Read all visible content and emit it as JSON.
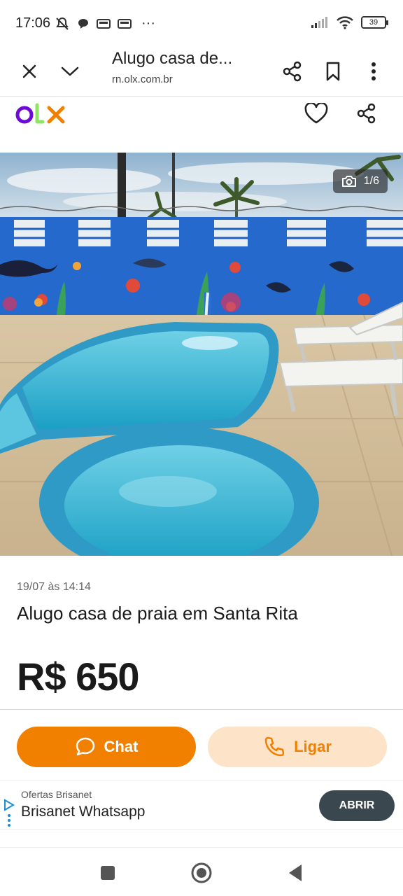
{
  "status_bar": {
    "time": "17:06",
    "notification_icons": [
      "mute-icon",
      "chat-icon",
      "news-icon",
      "news-icon"
    ],
    "more": "···",
    "battery": "39"
  },
  "browser": {
    "page_title": "Alugo casa de...",
    "domain": "rn.olx.com.br"
  },
  "olx": {
    "brand_colors": {
      "o": "#6e0ad6",
      "l": "#8ce563",
      "x": "#f28000"
    }
  },
  "photo": {
    "counter": "1/6",
    "description_icon": "camera-icon"
  },
  "listing": {
    "date": "19/07 às 14:14",
    "title": "Alugo casa de praia em Santa Rita",
    "price": "R$ 650"
  },
  "actions": {
    "chat_label": "Chat",
    "call_label": "Ligar",
    "accent": "#f28000"
  },
  "ad": {
    "sponsor": "Ofertas Brisanet",
    "title": "Brisanet Whatsapp",
    "cta": "ABRIR"
  }
}
